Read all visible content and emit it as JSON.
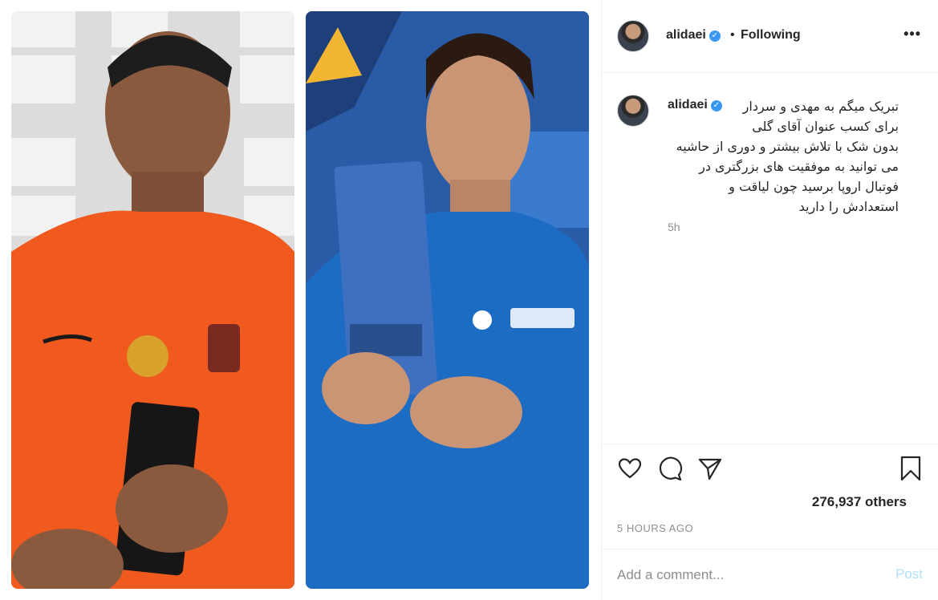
{
  "post": {
    "author": "alidaei",
    "verified": true,
    "follow_status": "Following",
    "separator": "•",
    "more_label": "•••"
  },
  "caption": {
    "author": "alidaei",
    "lines": [
      "تبریک میگم به مهدی و سردار",
      "برای کسب عنوان آقای گلی",
      "بدون شک با تلاش بیشتر و دوری از حاشیه",
      "می توانید به موفقیت های بزرگتری در",
      "فوتبال اروپا برسید چون لیاقت و",
      "استعدادش را دارید"
    ],
    "time_ago": "5h"
  },
  "actions": {
    "icons": [
      "heart-icon",
      "comment-icon",
      "share-icon",
      "bookmark-icon"
    ],
    "likes_text": "276,937 others",
    "timestamp": "5 HOURS AGO"
  },
  "comment": {
    "placeholder": "Add a comment...",
    "post_label": "Post"
  },
  "colors": {
    "verified": "#3897f0",
    "post_disabled": "#b2dffc",
    "muted": "#8e8e8e",
    "left_jersey": "#f05a1e",
    "right_jersey": "#1f5aa8"
  }
}
